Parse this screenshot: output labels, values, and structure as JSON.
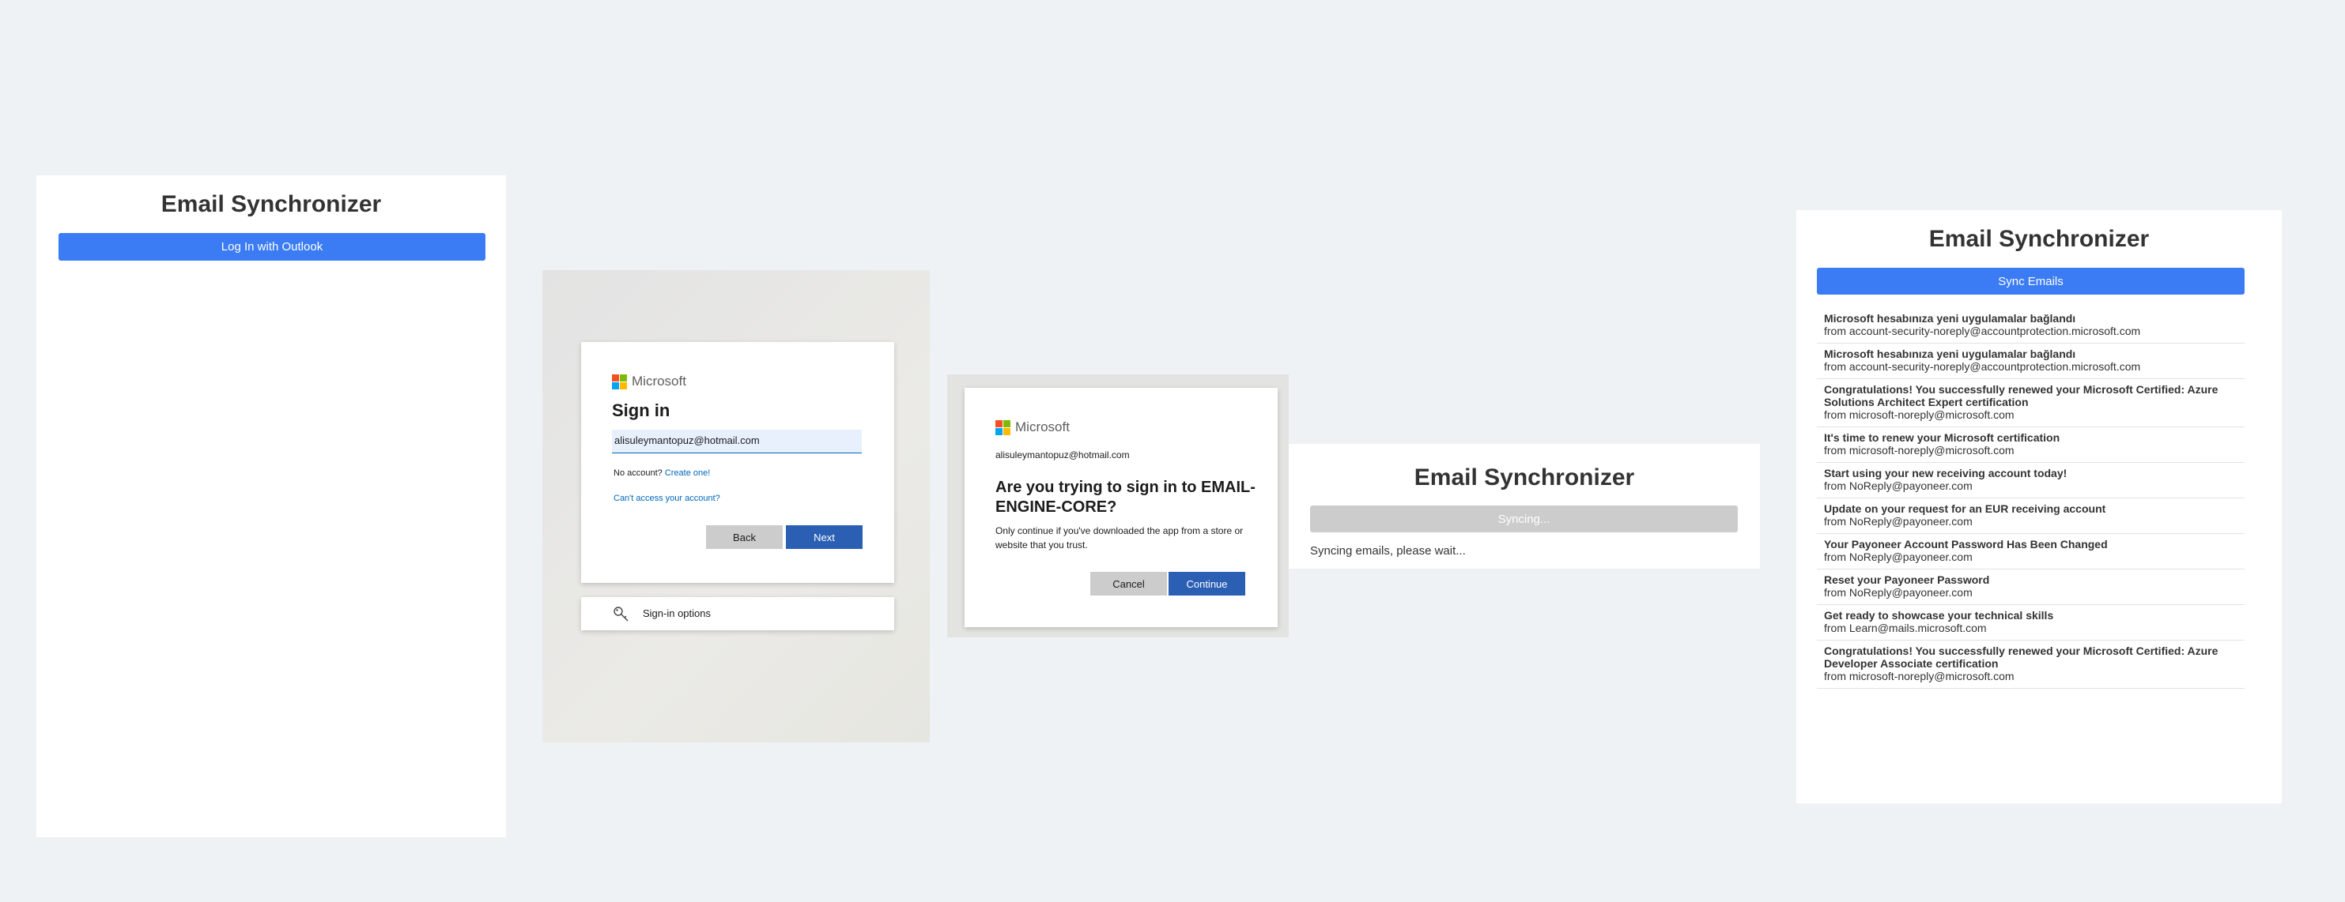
{
  "panel1": {
    "title": "Email Synchronizer",
    "login_label": "Log In with Outlook"
  },
  "signin": {
    "brand": "Microsoft",
    "title": "Sign in",
    "email_value": "alisuleymantopuz@hotmail.com",
    "no_account": "No account?",
    "create_link": "Create one!",
    "cant_access": "Can't access your account?",
    "back_label": "Back",
    "next_label": "Next",
    "options_label": "Sign-in options"
  },
  "consent": {
    "brand": "Microsoft",
    "account": "alisuleymantopuz@hotmail.com",
    "question": "Are you trying to sign in to EMAIL-ENGINE-CORE?",
    "description": "Only continue if you've downloaded the app from a store or website that you trust.",
    "cancel_label": "Cancel",
    "continue_label": "Continue"
  },
  "syncing": {
    "title": "Email Synchronizer",
    "button_label": "Syncing...",
    "status": "Syncing emails, please wait..."
  },
  "emails": {
    "title": "Email Synchronizer",
    "sync_label": "Sync Emails",
    "items": [
      {
        "subject": "Microsoft hesabınıza yeni uygulamalar bağlandı",
        "from": "from account-security-noreply@accountprotection.microsoft.com"
      },
      {
        "subject": "Microsoft hesabınıza yeni uygulamalar bağlandı",
        "from": "from account-security-noreply@accountprotection.microsoft.com"
      },
      {
        "subject": "Congratulations! You successfully renewed your Microsoft Certified: Azure Solutions Architect Expert certification",
        "from": "from microsoft-noreply@microsoft.com"
      },
      {
        "subject": "It's time to renew your Microsoft certification",
        "from": "from microsoft-noreply@microsoft.com"
      },
      {
        "subject": "Start using your new receiving account today!",
        "from": "from NoReply@payoneer.com"
      },
      {
        "subject": "Update on your request for an EUR receiving account",
        "from": "from NoReply@payoneer.com"
      },
      {
        "subject": "Your Payoneer Account Password Has Been Changed",
        "from": "from NoReply@payoneer.com"
      },
      {
        "subject": "Reset your Payoneer Password",
        "from": "from NoReply@payoneer.com"
      },
      {
        "subject": "Get ready to showcase your technical skills",
        "from": "from Learn@mails.microsoft.com"
      },
      {
        "subject": "Congratulations! You successfully renewed your Microsoft Certified: Azure Developer Associate certification",
        "from": "from microsoft-noreply@microsoft.com"
      }
    ]
  },
  "colors": {
    "primary": "#3b7cf4",
    "ms_blue": "#2b5fb4",
    "disabled": "#cccccc",
    "page_bg": "#eff2f5"
  },
  "icons": {
    "ms_logo": "microsoft-logo-icon",
    "key": "key-icon"
  }
}
